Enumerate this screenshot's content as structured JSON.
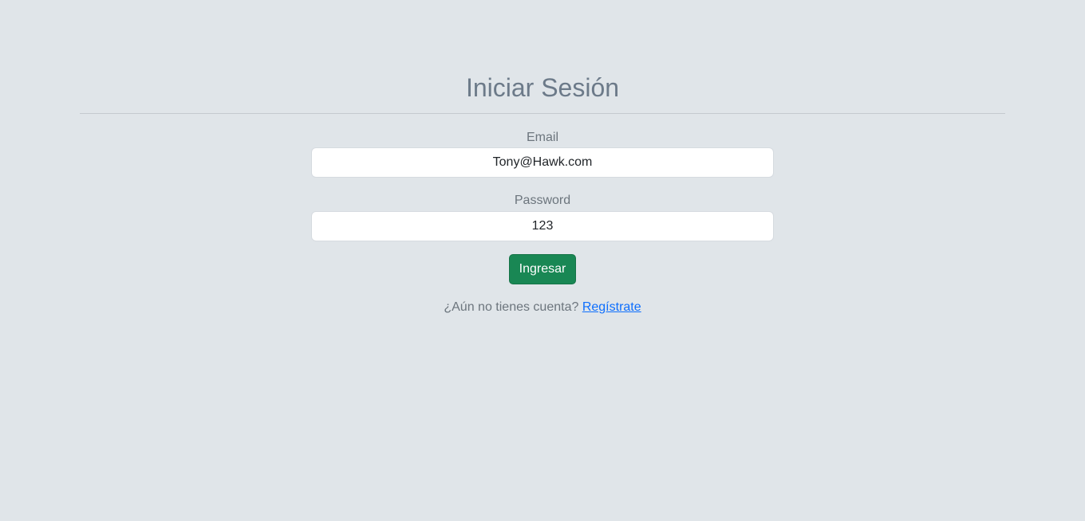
{
  "page": {
    "title": "Iniciar Sesión"
  },
  "form": {
    "email": {
      "label": "Email",
      "value": "Tony@Hawk.com"
    },
    "password": {
      "label": "Password",
      "value": "123"
    },
    "submit_label": "Ingresar"
  },
  "register": {
    "prompt": "¿Aún no tienes cuenta?",
    "link_label": "Regístrate"
  },
  "colors": {
    "background": "#e0e5e9",
    "accent_button": "#198754",
    "link": "#0d6efd"
  }
}
